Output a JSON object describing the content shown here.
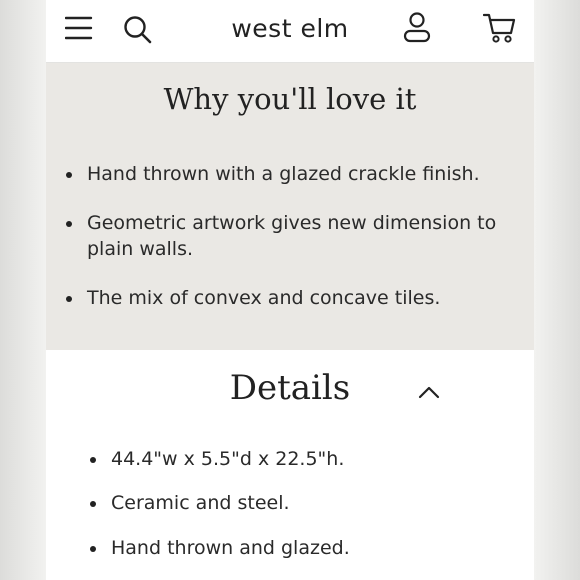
{
  "header": {
    "brand": "west elm",
    "icons": [
      "menu-icon",
      "search-icon",
      "account-icon",
      "cart-icon"
    ]
  },
  "love_section": {
    "title": "Why you'll love it",
    "bullets": [
      "Hand thrown with a glazed crackle finish.",
      "Geometric artwork gives new dimension to",
      "plain walls.",
      "The mix of convex and concave tiles."
    ]
  },
  "details_section": {
    "title": "Details",
    "expanded": true,
    "bullets": [
      "44.4\"w x 5.5\"d x 22.5\"h.",
      "Ceramic and steel.",
      "Hand thrown and glazed."
    ]
  },
  "colors": {
    "love_background": "#eae8e4",
    "text": "#222222"
  }
}
